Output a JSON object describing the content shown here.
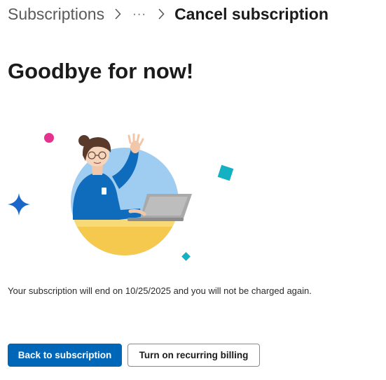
{
  "breadcrumb": {
    "root_label": "Subscriptions",
    "ellipsis": "···",
    "current_label": "Cancel subscription"
  },
  "page": {
    "title": "Goodbye for now!",
    "message": "Your subscription will end on 10/25/2025 and you will not be charged again."
  },
  "actions": {
    "primary_label": "Back to subscription",
    "secondary_label": "Turn on recurring billing"
  },
  "colors": {
    "accent": "#0067b8",
    "circle": "#9fcdf1",
    "desk": "#f5c94e",
    "sweater": "#0f6cbd",
    "sparkle_pink": "#e3338f",
    "sparkle_teal": "#14b1c2",
    "sparkle_blue": "#1a67c9"
  },
  "icons": {
    "separator": "chevron-right-icon",
    "overflow": "more-horizontal-icon"
  }
}
